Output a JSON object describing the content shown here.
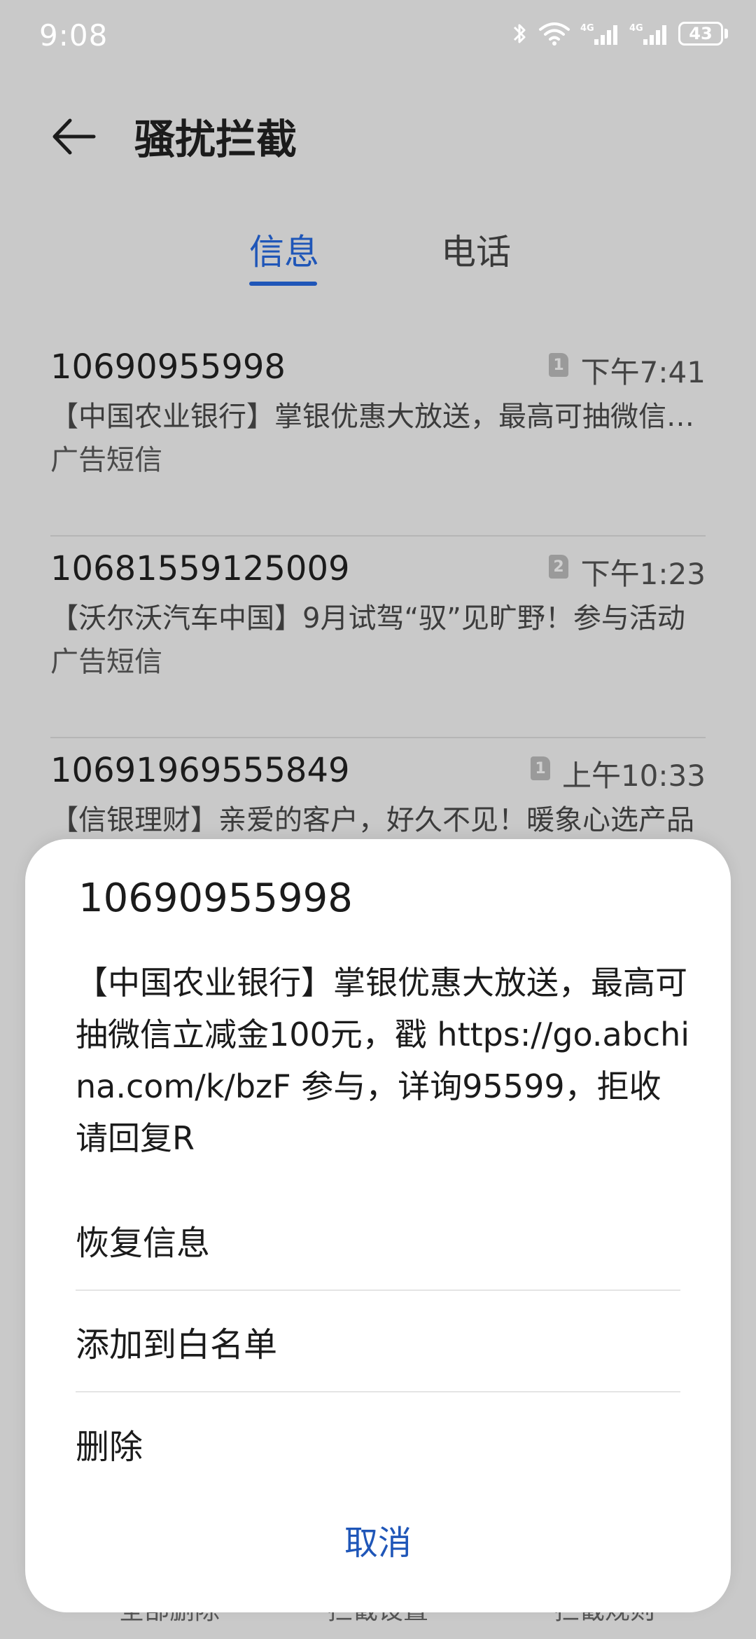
{
  "status_bar": {
    "time": "9:08",
    "battery": "43",
    "network_1": "4G",
    "network_2": "4G"
  },
  "header": {
    "title": "骚扰拦截"
  },
  "tabs": [
    {
      "label": "信息",
      "active": true
    },
    {
      "label": "电话",
      "active": false
    }
  ],
  "messages": [
    {
      "number": "10690955998",
      "sim": "1",
      "time": "下午7:41",
      "preview": "【中国农业银行】掌银优惠大放送，最高可抽微信立减金100元",
      "tag": "广告短信"
    },
    {
      "number": "10681559125009",
      "sim": "2",
      "time": "下午1:23",
      "preview": "【沃尔沃汽车中国】9月试驾“驭”见旷野！参与活动",
      "tag": "广告短信"
    },
    {
      "number": "10691969555849",
      "sim": "1",
      "time": "上午10:33",
      "preview": "【信银理财】亲爱的客户，好久不见！暖象心选产品",
      "tag": ""
    }
  ],
  "bottom_bar": {
    "left": "全部删除",
    "center": "拦截设置",
    "right": "拦截规则"
  },
  "sheet": {
    "number": "10690955998",
    "body": "【中国农业银行】掌银优惠大放送，最高可抽微信立减金100元，戳 https://go.abchina.com/k/bzF 参与，详询95599，拒收请回复R",
    "actions": [
      "恢复信息",
      "添加到白名单",
      "删除"
    ],
    "cancel": "取消"
  },
  "colors": {
    "accent": "#1f56b8",
    "background": "#c9c9c9",
    "sheet": "#ffffff"
  }
}
